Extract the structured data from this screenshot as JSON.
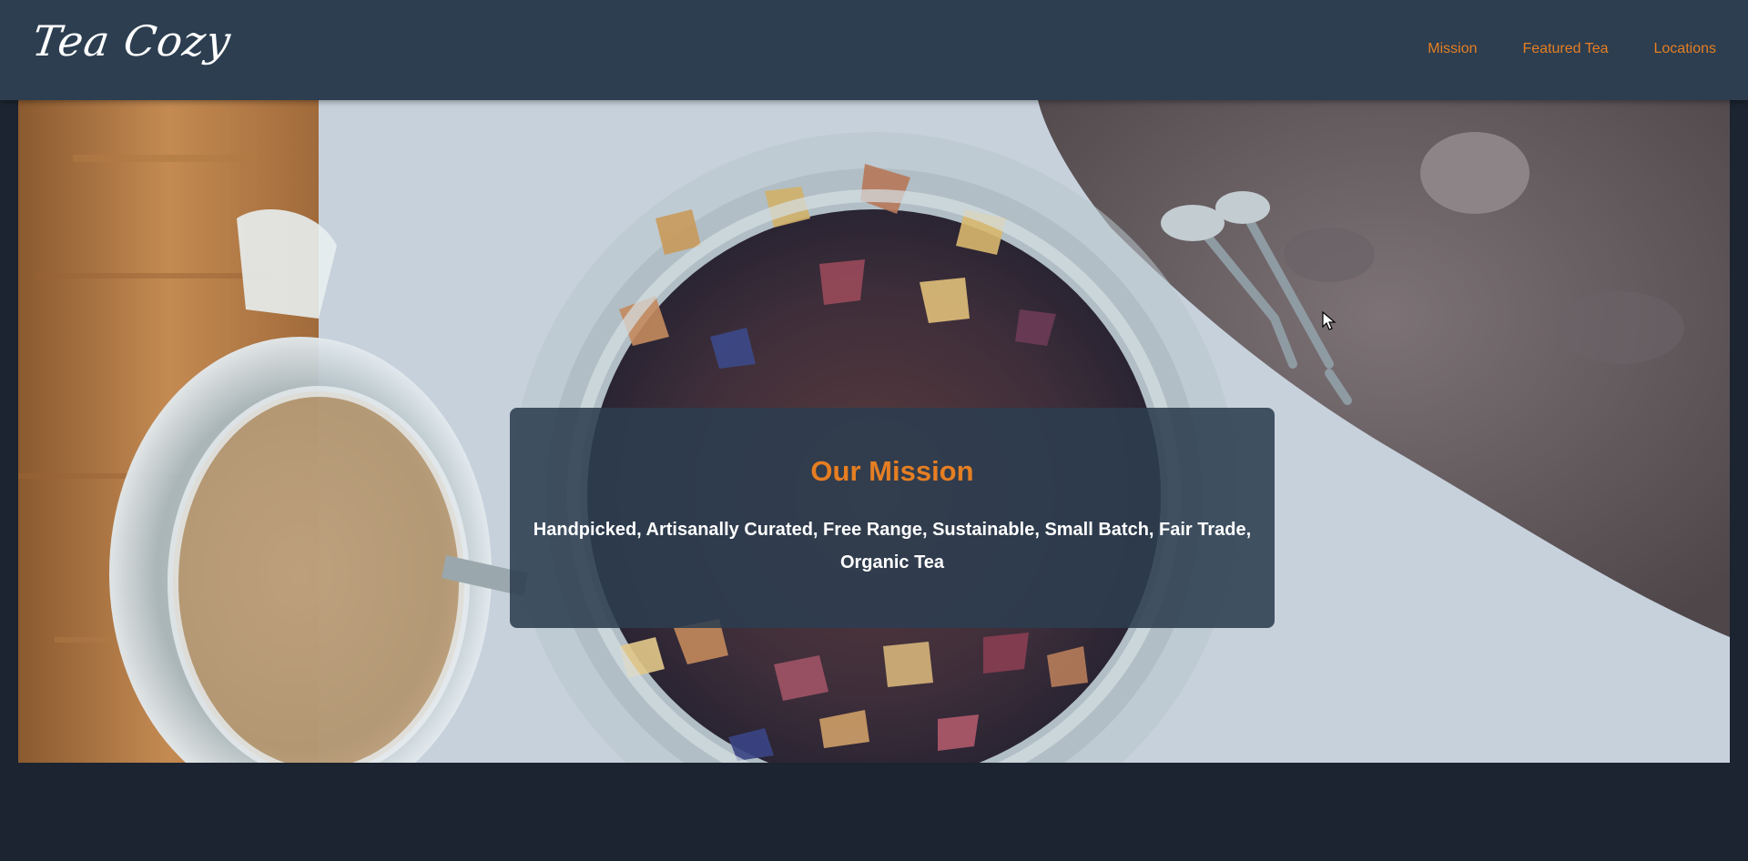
{
  "header": {
    "logo": "Tea Cozy",
    "nav": [
      {
        "label": "Mission"
      },
      {
        "label": "Featured Tea"
      },
      {
        "label": "Locations"
      }
    ]
  },
  "mission": {
    "title": "Our Mission",
    "text": "Handpicked, Artisanally Curated, Free Range, Sustainable, Small Batch, Fair Trade, Organic Tea"
  },
  "colors": {
    "header_bg": "#2c3e50",
    "accent": "#e67e22",
    "page_bg": "#1b2430"
  },
  "icons": {
    "cursor": "cursor-arrow-icon"
  }
}
